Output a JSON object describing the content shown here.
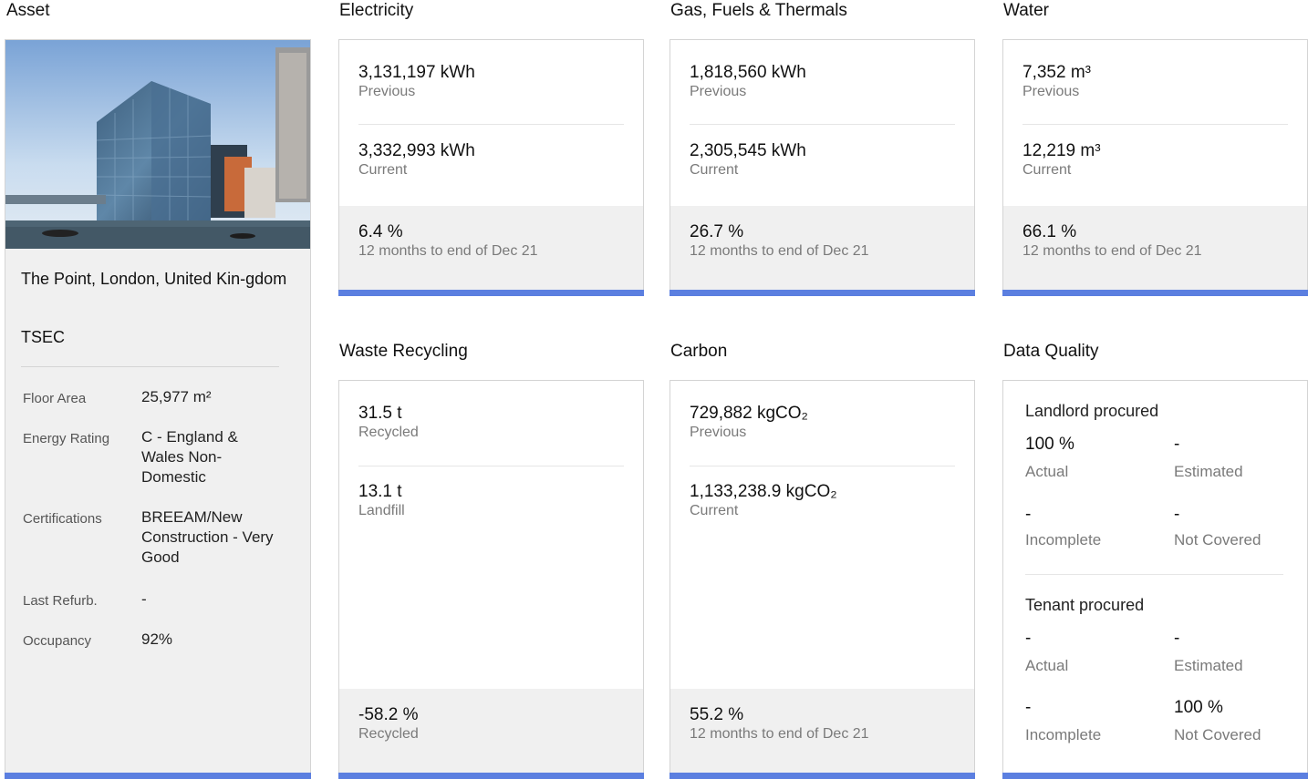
{
  "titles": {
    "asset": "Asset",
    "electricity": "Electricity",
    "gas": "Gas, Fuels & Thermals",
    "water": "Water",
    "waste": "Waste Recycling",
    "carbon": "Carbon",
    "data_quality": "Data Quality"
  },
  "asset": {
    "name": "The Point, London, United Kin-gdom",
    "code": "TSEC",
    "properties": [
      {
        "label": "Floor Area",
        "value": "25,977 m²"
      },
      {
        "label": "Energy Rating",
        "value": "C - England & Wales Non-Domestic"
      },
      {
        "label": "Certifications",
        "value": "BREEAM/New Construction - Very Good"
      },
      {
        "label": "Last Refurb.",
        "value": "-"
      },
      {
        "label": "Occupancy",
        "value": "92%"
      }
    ]
  },
  "electricity": {
    "previous_value": "3,131,197 kWh",
    "previous_label": "Previous",
    "current_value": "3,332,993 kWh",
    "current_label": "Current",
    "change_value": "6.4 %",
    "change_label": "12 months to end of Dec 21"
  },
  "gas": {
    "previous_value": "1,818,560 kWh",
    "previous_label": "Previous",
    "current_value": "2,305,545 kWh",
    "current_label": "Current",
    "change_value": "26.7 %",
    "change_label": "12 months to end of Dec 21"
  },
  "water": {
    "previous_value": "7,352 m³",
    "previous_label": "Previous",
    "current_value": "12,219 m³",
    "current_label": "Current",
    "change_value": "66.1 %",
    "change_label": "12 months to end of Dec 21"
  },
  "waste": {
    "recycled_value": "31.5 t",
    "recycled_label": "Recycled",
    "landfill_value": "13.1 t",
    "landfill_label": "Landfill",
    "change_value": "-58.2 %",
    "change_label": "Recycled"
  },
  "carbon": {
    "previous_value": "729,882 kgCO₂",
    "previous_label": "Previous",
    "current_value": "1,133,238.9 kgCO₂",
    "current_label": "Current",
    "change_value": "55.2 %",
    "change_label": "12 months to end of Dec 21"
  },
  "data_quality": {
    "landlord": {
      "heading": "Landlord procured",
      "actual": "100 %",
      "actual_label": "Actual",
      "estimated": "-",
      "estimated_label": "Estimated",
      "incomplete": "-",
      "incomplete_label": "Incomplete",
      "not_covered": "-",
      "not_covered_label": "Not Covered"
    },
    "tenant": {
      "heading": "Tenant procured",
      "actual": "-",
      "actual_label": "Actual",
      "estimated": "-",
      "estimated_label": "Estimated",
      "incomplete": "-",
      "incomplete_label": "Incomplete",
      "not_covered": "100 %",
      "not_covered_label": "Not Covered"
    }
  },
  "colors": {
    "accent": "#5b7fe0",
    "footer_bg": "#f0f0f0"
  }
}
